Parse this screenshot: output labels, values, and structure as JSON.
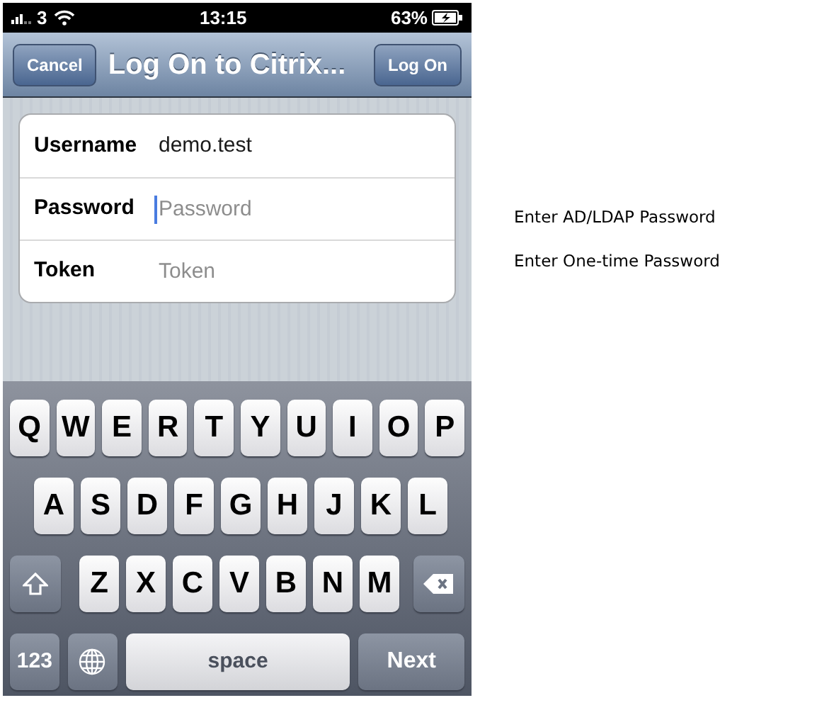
{
  "status_bar": {
    "carrier": "3",
    "time": "13:15",
    "battery": "63%"
  },
  "nav_bar": {
    "left_button": "Cancel",
    "title": "Log On to Citrix...",
    "right_button": "Log On"
  },
  "fields": [
    {
      "label": "Username",
      "value": "demo.test",
      "focused": false
    },
    {
      "label": "Password",
      "placeholder": "Password",
      "focused": true
    },
    {
      "label": "Token",
      "placeholder": "Token",
      "focused": false
    }
  ],
  "keyboard": {
    "rows": [
      [
        "Q",
        "W",
        "E",
        "R",
        "T",
        "Y",
        "U",
        "I",
        "O",
        "P"
      ],
      [
        "A",
        "S",
        "D",
        "F",
        "G",
        "H",
        "J",
        "K",
        "L"
      ],
      [
        "Z",
        "X",
        "C",
        "V",
        "B",
        "N",
        "M"
      ]
    ],
    "numbers_key": "123",
    "space_key": "space",
    "return_key": "Next"
  },
  "notes": [
    "Enter AD/LDAP Password",
    "Enter One-time Password"
  ]
}
